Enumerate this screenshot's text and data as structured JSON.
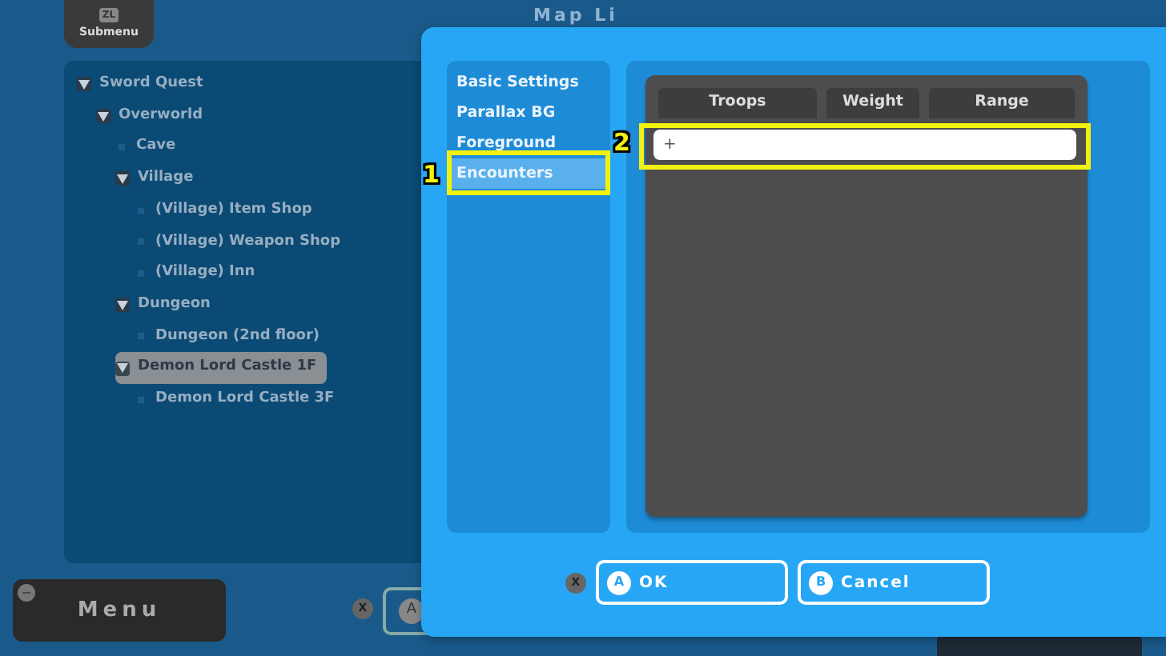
{
  "background": {
    "submenu_button": {
      "key": "ZL",
      "label": "Submenu"
    },
    "title": "Map Li",
    "tree": [
      {
        "label": "Sword Quest",
        "selected": false,
        "children": [
          {
            "label": "Overworld",
            "selected": false,
            "children": [
              {
                "label": "Cave",
                "selected": false
              },
              {
                "label": "Village",
                "selected": false,
                "children": [
                  {
                    "label": "(Village) Item Shop",
                    "selected": false
                  },
                  {
                    "label": "(Village) Weapon Shop",
                    "selected": false
                  },
                  {
                    "label": "(Village) Inn",
                    "selected": false
                  }
                ]
              },
              {
                "label": "Dungeon",
                "selected": false,
                "children": [
                  {
                    "label": "Dungeon (2nd floor)",
                    "selected": false
                  }
                ]
              },
              {
                "label": "Demon Lord Castle 1F",
                "selected": true,
                "children": [
                  {
                    "label": "Demon Lord Castle 3F",
                    "selected": false
                  }
                ]
              }
            ]
          }
        ]
      }
    ],
    "menu_button": {
      "key": "−",
      "label": "Menu"
    },
    "x_key": "X",
    "a_key": "A"
  },
  "dialog": {
    "tabs": [
      {
        "label": "Basic Settings",
        "selected": false
      },
      {
        "label": "Parallax BG",
        "selected": false
      },
      {
        "label": "Foreground",
        "selected": false
      },
      {
        "label": "Encounters",
        "selected": true
      }
    ],
    "table": {
      "columns": [
        "Troops",
        "Weight",
        "Range"
      ],
      "add_row": "+"
    },
    "x_key": "X",
    "buttons": [
      {
        "key": "A",
        "label": "OK"
      },
      {
        "key": "B",
        "label": "Cancel"
      }
    ]
  },
  "callouts": [
    "1",
    "2"
  ]
}
